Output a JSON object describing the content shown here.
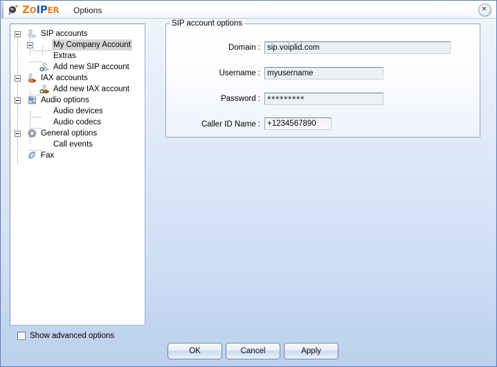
{
  "window": {
    "app_icon": "zoiper-headset-icon",
    "logo_part1": "Z",
    "logo_part2": "O",
    "logo_part3": "IP",
    "logo_part4": "ER",
    "title": "Options",
    "close_label": "✕"
  },
  "tree": {
    "items": [
      {
        "label": "SIP accounts",
        "indent": 0,
        "icon": "sip-accounts-icon",
        "toggle": "minus",
        "selected": false
      },
      {
        "label": "My Company Account",
        "indent": 1,
        "icon": "none",
        "toggle": "minus",
        "selected": true
      },
      {
        "label": "Extras",
        "indent": 2,
        "icon": "none",
        "toggle": "none",
        "selected": false
      },
      {
        "label": "Add new SIP account",
        "indent": 1,
        "icon": "add-sip-account-icon",
        "toggle": "none",
        "selected": false
      },
      {
        "label": "IAX accounts",
        "indent": 0,
        "icon": "iax-accounts-icon",
        "toggle": "minus",
        "selected": false
      },
      {
        "label": "Add new IAX account",
        "indent": 1,
        "icon": "add-iax-account-icon",
        "toggle": "none",
        "selected": false
      },
      {
        "label": "Audio options",
        "indent": 0,
        "icon": "music-note-icon",
        "toggle": "minus",
        "selected": false
      },
      {
        "label": "Audio devices",
        "indent": 1,
        "icon": "none",
        "toggle": "none",
        "selected": false
      },
      {
        "label": "Audio codecs",
        "indent": 1,
        "icon": "none",
        "toggle": "none",
        "selected": false
      },
      {
        "label": "General options",
        "indent": 0,
        "icon": "gear-icon",
        "toggle": "minus",
        "selected": false
      },
      {
        "label": "Call events",
        "indent": 1,
        "icon": "none",
        "toggle": "none",
        "selected": false
      },
      {
        "label": "Fax",
        "indent": 0,
        "icon": "fax-icon",
        "toggle": "none",
        "selected": false
      }
    ]
  },
  "groupbox": {
    "title": "SIP account options",
    "fields": [
      {
        "label": "Domain :",
        "value": "sip.voiplid.com",
        "type": "text"
      },
      {
        "label": "Username :",
        "value": "myusername",
        "type": "text"
      },
      {
        "label": "Password :",
        "value": "*********",
        "type": "password"
      },
      {
        "label": "Caller ID Name :",
        "value": "+1234567890",
        "type": "text"
      }
    ]
  },
  "footer": {
    "checkbox_label": "Show advanced options",
    "checkbox_checked": false,
    "ok_label": "OK",
    "cancel_label": "Cancel",
    "apply_label": "Apply"
  },
  "colors": {
    "logo_orange": "#ef7d1a",
    "logo_blue": "#1f5fa8",
    "window_bg_top": "#fdfeff",
    "window_bg_bottom": "#bdd1ee",
    "selection_gray": "#d6d6d6"
  }
}
